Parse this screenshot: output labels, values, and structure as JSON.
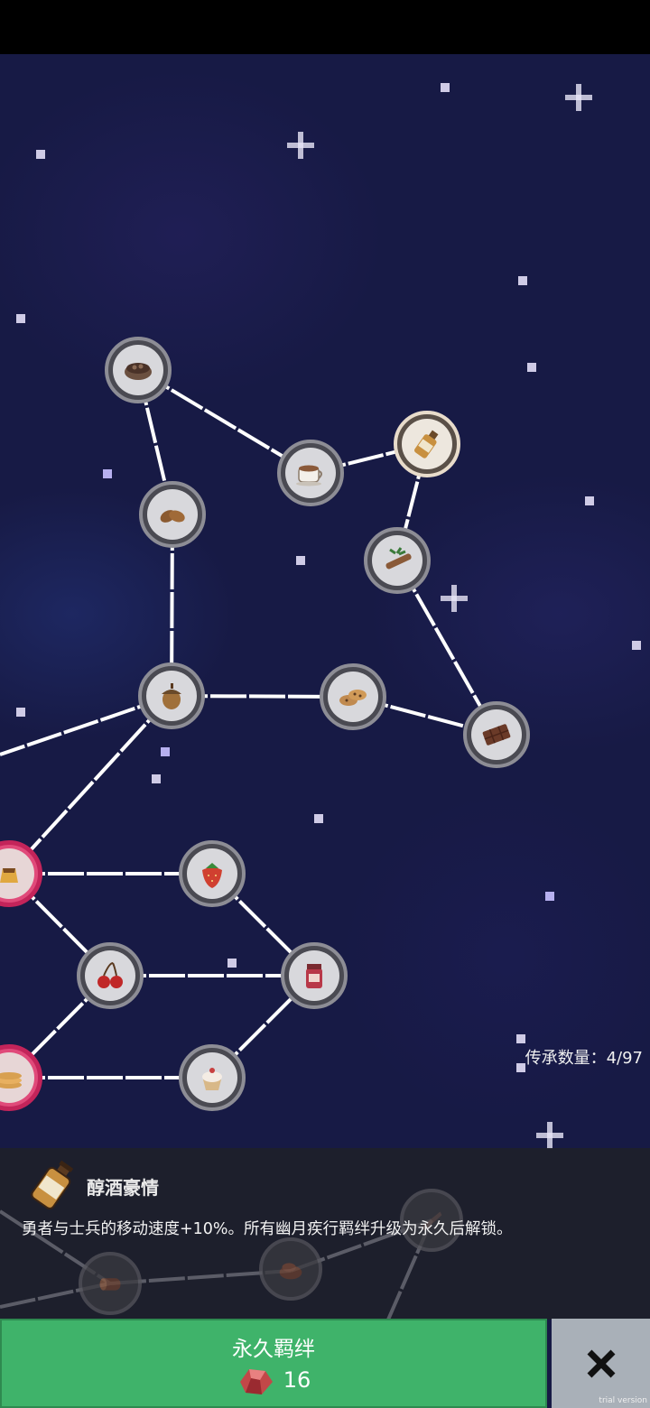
{
  "legacy_count": {
    "label": "传承数量：",
    "current": 4,
    "total": 97,
    "text": "传承数量：4/97"
  },
  "constellation": {
    "nodes": [
      {
        "name": "bowl-of-beans",
        "state": "normal"
      },
      {
        "name": "coffee-cup",
        "state": "normal"
      },
      {
        "name": "liquor-bottle",
        "state": "selected"
      },
      {
        "name": "potatoes",
        "state": "normal"
      },
      {
        "name": "cinnamon-stick",
        "state": "normal"
      },
      {
        "name": "acorn",
        "state": "normal"
      },
      {
        "name": "cookies",
        "state": "normal"
      },
      {
        "name": "chocolate-bar",
        "state": "normal"
      },
      {
        "name": "pudding",
        "state": "unlocked"
      },
      {
        "name": "strawberry",
        "state": "normal"
      },
      {
        "name": "cherries",
        "state": "normal"
      },
      {
        "name": "jam-jar",
        "state": "normal"
      },
      {
        "name": "pancakes",
        "state": "unlocked"
      },
      {
        "name": "cupcake",
        "state": "normal"
      }
    ]
  },
  "detail_panel": {
    "title": "醇酒豪情",
    "description": "勇者与士兵的移动速度+10%。所有幽月疾行羁绊升级为永久后解锁。",
    "icon": "liquor-bottle-icon"
  },
  "bond_button": {
    "label": "永久羁绊",
    "cost": "16",
    "currency_icon": "red-gem-icon"
  },
  "close_button": {
    "icon": "close-icon"
  },
  "watermark": "trial version",
  "colors": {
    "sky": "#171a45",
    "button_green": "#3fb36a",
    "close_gray": "#a9b0b8",
    "unlocked_ring": "#e04a7a",
    "selected_ring": "#e8dccb"
  }
}
